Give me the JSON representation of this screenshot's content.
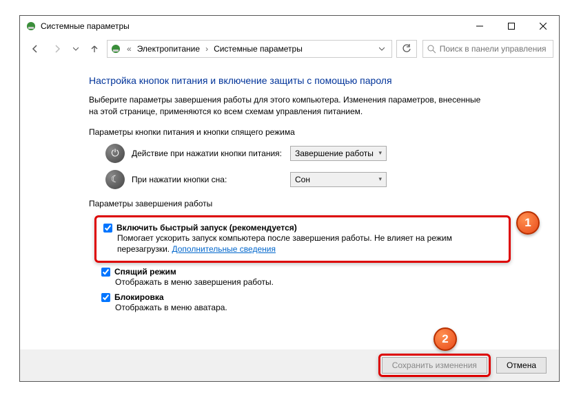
{
  "title": "Системные параметры",
  "breadcrumb": {
    "prefix_sep": "«",
    "crumb1": "Электропитание",
    "crumb2": "Системные параметры"
  },
  "search": {
    "placeholder": "Поиск в панели управления"
  },
  "heading": "Настройка кнопок питания и включение защиты с помощью пароля",
  "description": "Выберите параметры завершения работы для этого компьютера. Изменения параметров, внесенные на этой странице, применяются ко всем схемам управления питанием.",
  "section_buttons": "Параметры кнопки питания и кнопки спящего режима",
  "power_button": {
    "label": "Действие при нажатии кнопки питания:",
    "value": "Завершение работы"
  },
  "sleep_button": {
    "label": "При нажатии кнопки сна:",
    "value": "Сон"
  },
  "section_shutdown": "Параметры завершения работы",
  "fast_startup": {
    "title": "Включить быстрый запуск (рекомендуется)",
    "desc_line": "Помогает ускорить запуск компьютера после завершения работы. Не влияет на режим перезагрузки. ",
    "link": "Дополнительные сведения"
  },
  "sleep_opt": {
    "title": "Спящий режим",
    "desc": "Отображать в меню завершения работы."
  },
  "lock_opt": {
    "title": "Блокировка",
    "desc": "Отображать в меню аватара."
  },
  "buttons": {
    "save": "Сохранить изменения",
    "cancel": "Отмена"
  },
  "callouts": {
    "one": "1",
    "two": "2"
  }
}
